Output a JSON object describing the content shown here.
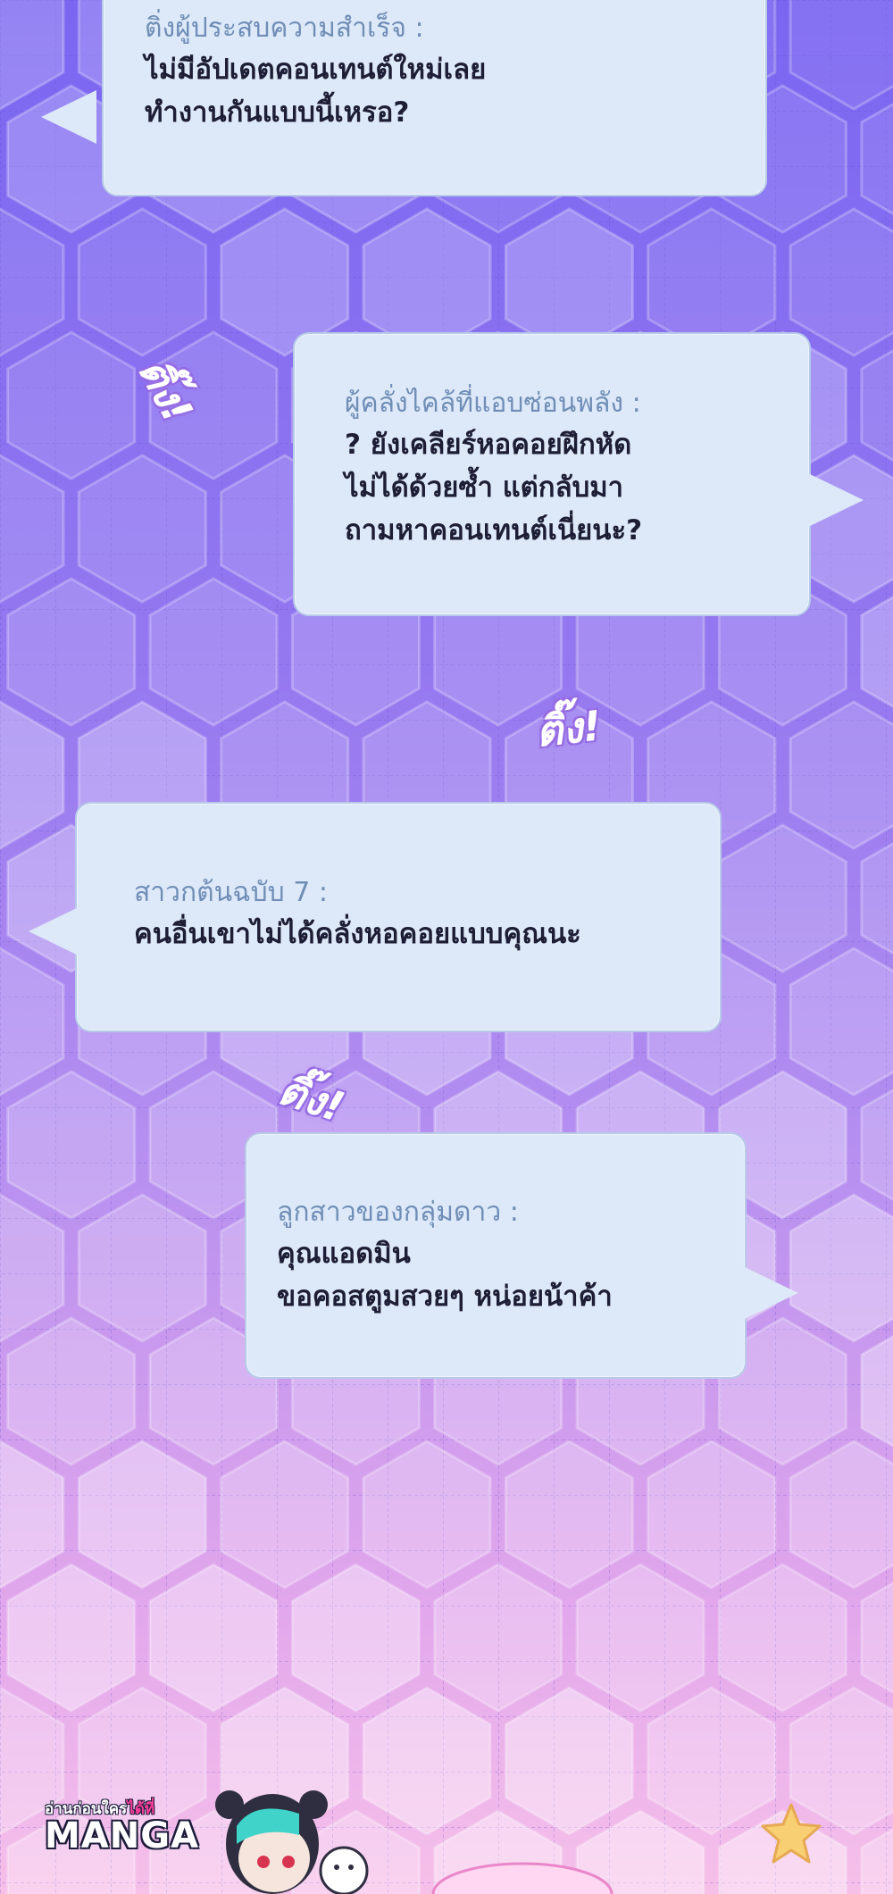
{
  "colors": {
    "bubble_fill": "#dde9f8",
    "bubble_border": "#b7cbe8",
    "speaker_text": "#6f8db6",
    "message_text": "#1d1d35",
    "bg_top": "#7763f0",
    "bg_mid": "#a281f2",
    "bg_bottom": "#f0b6e9"
  },
  "messages": [
    {
      "speaker": "ติ่งผู้ประสบความสำเร็จ :",
      "lines": [
        "ไม่มีอัปเดตคอนเทนต์ใหม่เลย",
        "ทำงานกันแบบนี้เหรอ?"
      ]
    },
    {
      "speaker": "ผู้คลั่งไคล้ที่แอบซ่อนพลัง :",
      "lines": [
        "? ยังเคลียร์หอคอยฝึกหัด",
        "ไม่ได้ด้วยซ้ำ แต่กลับมา",
        "ถามหาคอนเทนต์เนี่ยนะ?"
      ]
    },
    {
      "speaker": "สาวกต้นฉบับ 7 :",
      "lines": [
        "คนอื่นเขาไม่ได้คลั่งหอคอยแบบคุณนะ"
      ]
    },
    {
      "speaker": "ลูกสาวของกลุ่มดาว :",
      "lines": [
        "คุณแอดมิน",
        "ขอคอสตูมสวยๆ หน่อยน้าค้า"
      ]
    }
  ],
  "sound_effects": [
    "ติ๊ง!",
    "ติ๊ง!",
    "ติ๊ง!"
  ],
  "watermark": {
    "small_text": "อ่านก่อนใคร",
    "small_accent": "ได้ที่",
    "brand": "MANGA"
  }
}
